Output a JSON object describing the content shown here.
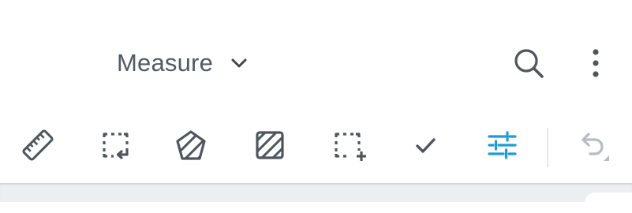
{
  "header": {
    "mode_label": "Measure"
  },
  "icons": {
    "chevron": "chevron-down-icon",
    "search": "search-icon",
    "more": "more-vertical-icon"
  },
  "toolbar": {
    "tools": [
      {
        "icon": "ruler-icon",
        "active": false
      },
      {
        "icon": "select-area-return-icon",
        "active": false
      },
      {
        "icon": "polygon-area-icon",
        "active": false
      },
      {
        "icon": "hatched-square-icon",
        "active": false
      },
      {
        "icon": "add-selection-icon",
        "active": false
      },
      {
        "icon": "checkmark-icon",
        "active": false
      },
      {
        "icon": "sliders-icon",
        "active": true
      },
      {
        "icon": "undo-icon",
        "active": false,
        "disabled": true
      }
    ],
    "colors": {
      "icon": "#4d565e",
      "active": "#1e9bd7",
      "disabled": "#b5bcc2"
    }
  }
}
